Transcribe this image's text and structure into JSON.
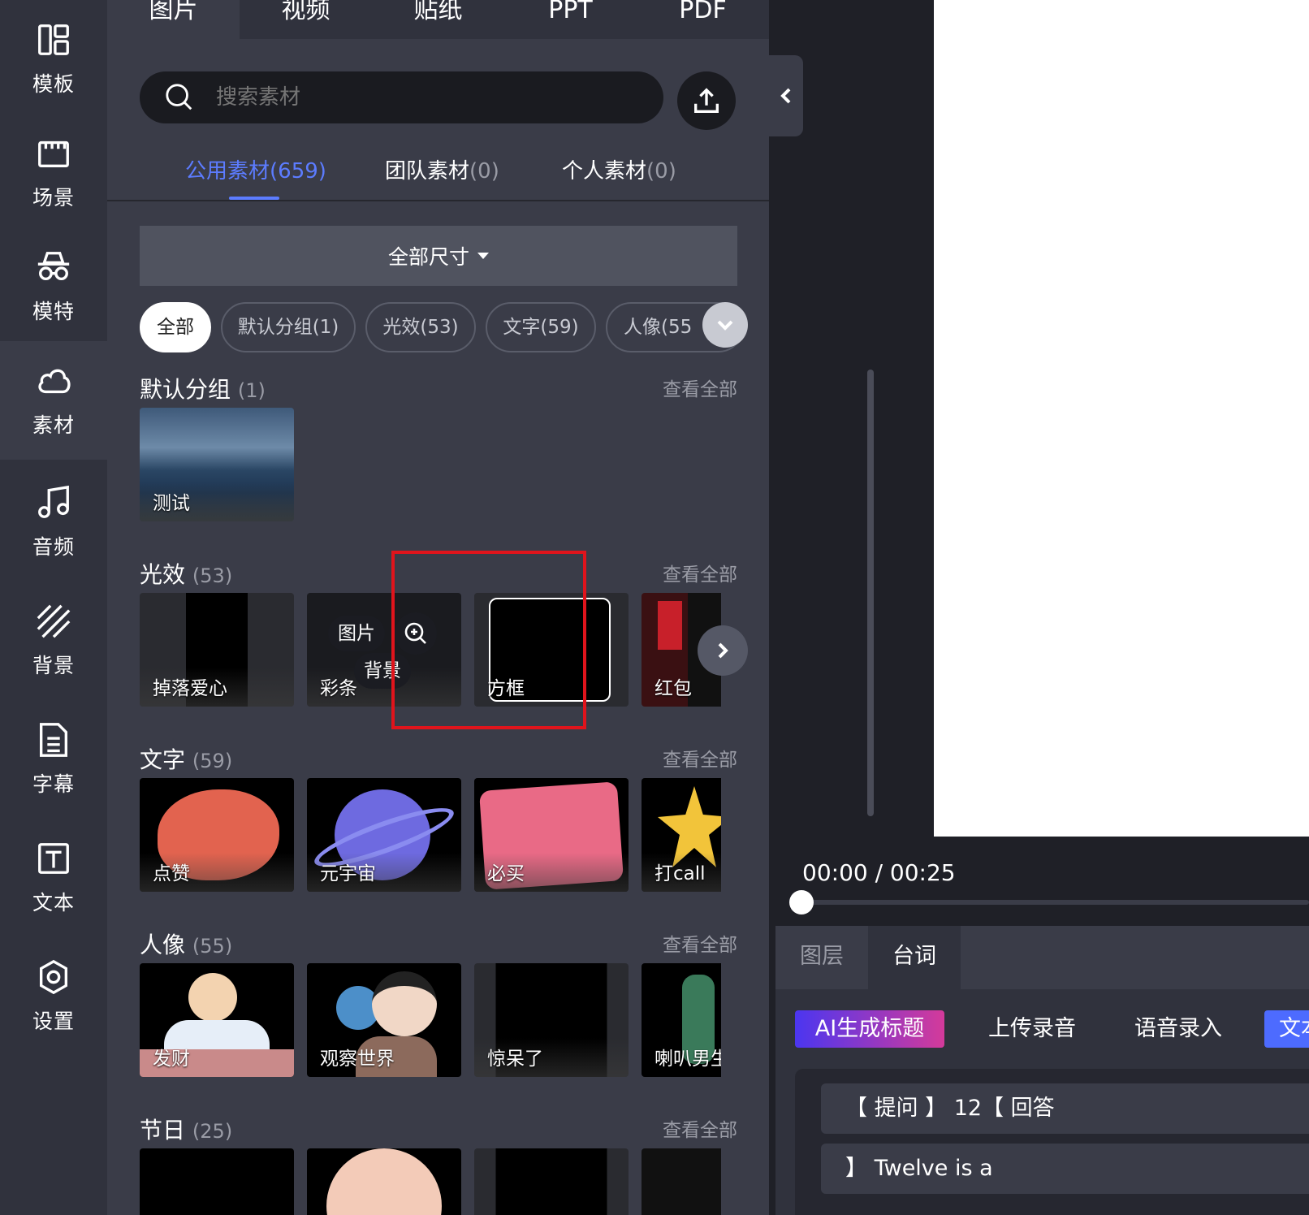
{
  "sidebar": {
    "items": [
      {
        "label": "模板",
        "icon": "layout-icon"
      },
      {
        "label": "场景",
        "icon": "clapper-icon"
      },
      {
        "label": "模特",
        "icon": "incognito-icon"
      },
      {
        "label": "素材",
        "icon": "cloud-icon"
      },
      {
        "label": "音频",
        "icon": "music-icon"
      },
      {
        "label": "背景",
        "icon": "stripes-icon"
      },
      {
        "label": "字幕",
        "icon": "document-icon"
      },
      {
        "label": "文本",
        "icon": "text-icon"
      },
      {
        "label": "设置",
        "icon": "gear-icon"
      }
    ],
    "active": "素材"
  },
  "top_tabs": [
    "图片",
    "视频",
    "贴纸",
    "PPT",
    "PDF"
  ],
  "search": {
    "placeholder": "搜索素材"
  },
  "source_tabs": [
    {
      "label": "公用素材",
      "count": "(659)"
    },
    {
      "label": "团队素材",
      "count": "(0)"
    },
    {
      "label": "个人素材",
      "count": "(0)"
    }
  ],
  "size_filter": "全部尺寸",
  "chips": [
    "全部",
    "默认分组(1)",
    "光效(53)",
    "文字(59)",
    "人像(55"
  ],
  "view_all": "查看全部",
  "sections": [
    {
      "title": "默认分组",
      "count": "(1)",
      "tiles": [
        "测试"
      ]
    },
    {
      "title": "光效",
      "count": "(53)",
      "tiles": [
        "掉落爱心",
        "彩条",
        "方框",
        "红包"
      ]
    },
    {
      "title": "文字",
      "count": "(59)",
      "tiles": [
        "点赞",
        "元宇宙",
        "必买",
        "打call"
      ]
    },
    {
      "title": "人像",
      "count": "(55)",
      "tiles": [
        "发财",
        "观察世界",
        "惊呆了",
        "喇叭男生"
      ]
    },
    {
      "title": "节日",
      "count": "(25)",
      "tiles": []
    }
  ],
  "hover_tags": {
    "image": "图片",
    "background": "背景"
  },
  "player": {
    "time": "00:00 / 00:25"
  },
  "bottom_tabs": [
    "图层",
    "台词"
  ],
  "bottom_actions": {
    "ai": "AI生成标题",
    "upload": "上传录音",
    "voice": "语音录入",
    "text": "文本"
  },
  "script_lines": [
    "【 提问 】 12【 回答",
    "】 Twelve is a"
  ],
  "colors": {
    "accent": "#5c7cff",
    "highlight": "#e0141c"
  }
}
